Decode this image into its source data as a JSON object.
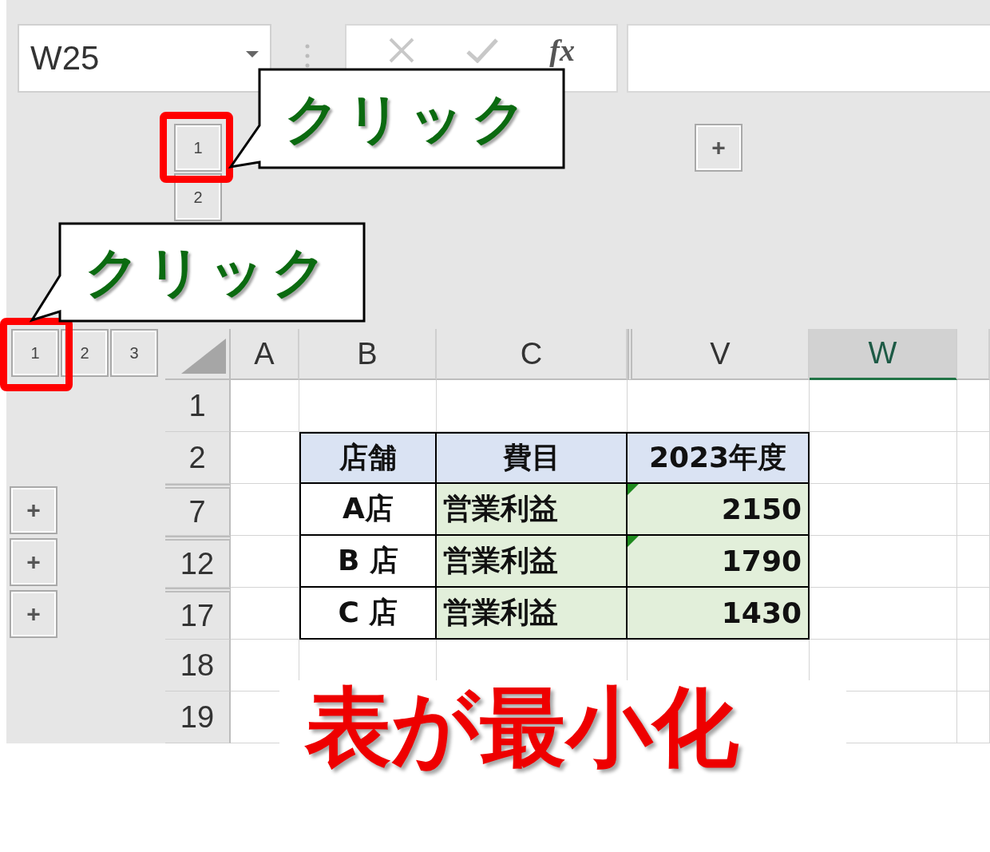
{
  "name_box": {
    "value": "W25"
  },
  "formula_bar": {
    "function_label": "fx"
  },
  "column_outline": {
    "levels": [
      "1",
      "2"
    ],
    "expand_buttons": [
      "+"
    ]
  },
  "row_outline": {
    "levels": [
      "1",
      "2",
      "3"
    ],
    "expand_buttons": [
      "+",
      "+",
      "+"
    ]
  },
  "columns": [
    {
      "label": "A",
      "selected": false,
      "collapsed_before": false
    },
    {
      "label": "B",
      "selected": false,
      "collapsed_before": false
    },
    {
      "label": "C",
      "selected": false,
      "collapsed_before": false
    },
    {
      "label": "V",
      "selected": false,
      "collapsed_before": true
    },
    {
      "label": "W",
      "selected": true,
      "collapsed_before": false
    }
  ],
  "rows": [
    {
      "label": "1",
      "collapsed_above": false
    },
    {
      "label": "2",
      "collapsed_above": false
    },
    {
      "label": "7",
      "collapsed_above": true
    },
    {
      "label": "12",
      "collapsed_above": true
    },
    {
      "label": "17",
      "collapsed_above": true
    },
    {
      "label": "18",
      "collapsed_above": false
    },
    {
      "label": "19",
      "collapsed_above": false
    }
  ],
  "table": {
    "header": [
      "店舗",
      "費目",
      "2023年度"
    ],
    "rows": [
      {
        "store": "A店",
        "item": "営業利益",
        "value": "2150",
        "error_flag": true
      },
      {
        "store": "B 店",
        "item": "営業利益",
        "value": "1790",
        "error_flag": true
      },
      {
        "store": "C 店",
        "item": "営業利益",
        "value": "1430",
        "error_flag": false
      }
    ]
  },
  "callouts": [
    {
      "text": "クリック"
    },
    {
      "text": "クリック"
    }
  ],
  "caption": "表が最小化"
}
